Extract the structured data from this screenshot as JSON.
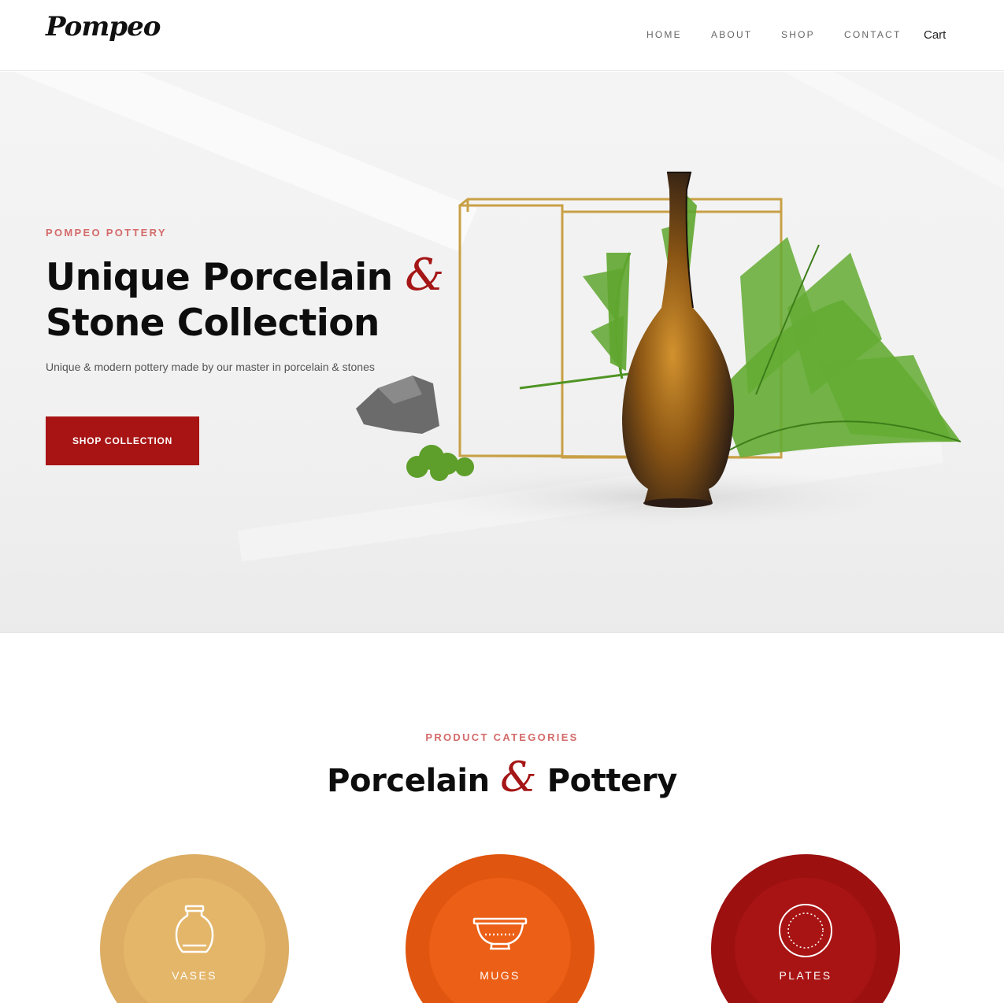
{
  "brand": {
    "name": "Pompeo"
  },
  "nav": {
    "items": [
      "HOME",
      "ABOUT",
      "SHOP",
      "CONTACT"
    ],
    "cart": "Cart"
  },
  "hero": {
    "eyebrow": "POMPEO POTTERY",
    "title_line1": "Unique Porcelain",
    "title_amp": "&",
    "title_line2": "Stone Collection",
    "subtitle": "Unique & modern pottery made by our master in porcelain & stones",
    "cta": "SHOP COLLECTION"
  },
  "categories": {
    "eyebrow": "PRODUCT CATEGORIES",
    "title_part1": "Porcelain",
    "title_amp": "&",
    "title_part2": "Pottery",
    "items": [
      {
        "label": "VASES",
        "icon": "vase-icon",
        "outer": "#dcad63",
        "inner": "#e4b66a"
      },
      {
        "label": "MUGS",
        "icon": "bowl-icon",
        "outer": "#e0550f",
        "inner": "#ec5f16"
      },
      {
        "label": "PLATES",
        "icon": "plate-icon",
        "outer": "#9c1010",
        "inner": "#a81414"
      }
    ]
  },
  "colors": {
    "accent": "#a81414",
    "eyebrow": "#d46a6a"
  }
}
